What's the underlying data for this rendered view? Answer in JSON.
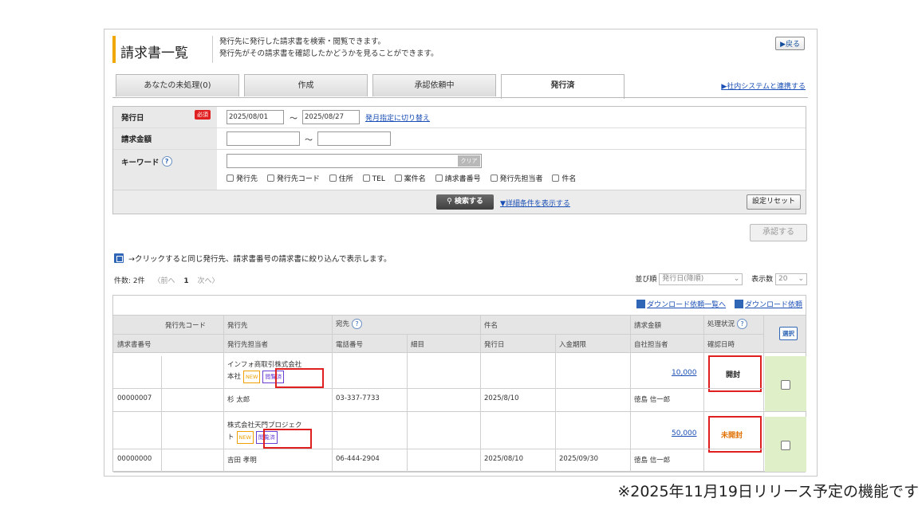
{
  "title": "請求書一覧",
  "description": [
    "発行先に発行した請求書を検索・閲覧できます。",
    "発行先がその請求書を確認したかどうかを見ることができます。"
  ],
  "back_button": "▶戻る",
  "tabs": [
    {
      "label": "あなたの未処理(0)"
    },
    {
      "label": "作成"
    },
    {
      "label": "承認依頼中"
    },
    {
      "label": "発行済"
    }
  ],
  "system_link": "▶社内システムと連携する",
  "search": {
    "issue_date_label": "発行日",
    "required_badge": "必須",
    "date_from": "2025/08/01",
    "date_to": "2025/08/27",
    "month_switch": "発月指定に切り替え",
    "amount_label": "請求金額",
    "keyword_label": "キーワード",
    "keyword_button": "クリア",
    "checkboxes": [
      "発行先",
      "発行先コード",
      "住所",
      "TEL",
      "案件名",
      "請求書番号",
      "発行先担当者",
      "件名"
    ],
    "search_button": "検索する",
    "detail_link": "▼詳細条件を表示する",
    "reset_button": "設定リセット"
  },
  "approve_button": "承認する",
  "legend_text": "→クリックすると同じ発行先、請求書番号の請求書に絞り込んで表示します。",
  "pager": {
    "count": "件数: 2件",
    "prev": "〈前へ",
    "page": "1",
    "next": "次へ〉"
  },
  "sort": {
    "sort_label": "並び順",
    "sort_value": "発行日(降順)",
    "display_label": "表示数",
    "display_value": "20"
  },
  "downloads": [
    "ダウンロード依頼一覧へ",
    "ダウンロード依頼"
  ],
  "headers": {
    "row1": [
      "発行先コード",
      "発行先",
      "宛先",
      "件名",
      "請求金額",
      "処理状況"
    ],
    "row2": [
      "請求書番号",
      "発行先担当者",
      "電話番号",
      "細目",
      "発行日",
      "入金期限",
      "自社担当者",
      "確認日時"
    ],
    "all_button": "選択"
  },
  "records": [
    {
      "issuer": "インフォ商取引株式会社",
      "issuer_line2": "本社",
      "new_tag": "NEW",
      "read_tag": "閲覧済",
      "amount": "10,000",
      "status": "開封",
      "status_color": "#333333",
      "invoice_no": "00000007",
      "contact": "杉 太郎",
      "phone": "03-337-7733",
      "issue_date": "2025/8/10",
      "due_date": "",
      "owner": "徳島 信一郎"
    },
    {
      "issuer": "株式会社天門プロジェク",
      "issuer_line2": "ト",
      "new_tag": "NEW",
      "read_tag": "閲覧済",
      "amount": "50,000",
      "status": "未開封",
      "status_color": "#e07000",
      "invoice_no": "00000000",
      "contact": "吉田 孝明",
      "phone": "06-444-2904",
      "issue_date": "2025/08/10",
      "due_date": "2025/09/30",
      "owner": "徳島 信一郎"
    }
  ],
  "footnote": "※2025年11月19日リリース予定の機能です"
}
